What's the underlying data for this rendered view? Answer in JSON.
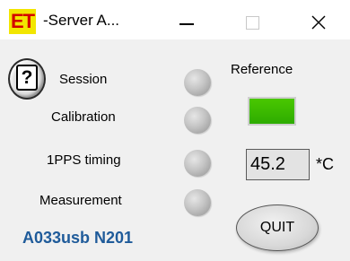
{
  "window": {
    "app_icon_text": "ET",
    "title": "-Server A...",
    "controls": [
      "minimize",
      "maximize",
      "close"
    ]
  },
  "help_button": {
    "label": "?"
  },
  "status_indicators": [
    {
      "label": "Session",
      "state": "off"
    },
    {
      "label": "Calibration",
      "state": "off"
    },
    {
      "label": "1PPS timing",
      "state": "off"
    },
    {
      "label": "Measurement",
      "state": "off"
    }
  ],
  "reference": {
    "label": "Reference",
    "state": "on",
    "color": "#3cbe00"
  },
  "temperature": {
    "value": "45.2",
    "unit": "*C"
  },
  "device_id": "A033usb N201",
  "quit_button": {
    "label": "QUIT"
  },
  "colors": {
    "app_icon_bg": "#f2e600",
    "app_icon_text": "#d40000",
    "device_id_text": "#1f5b9a",
    "led_off": "#b8b8b8",
    "led_on": "#3cbe00"
  }
}
